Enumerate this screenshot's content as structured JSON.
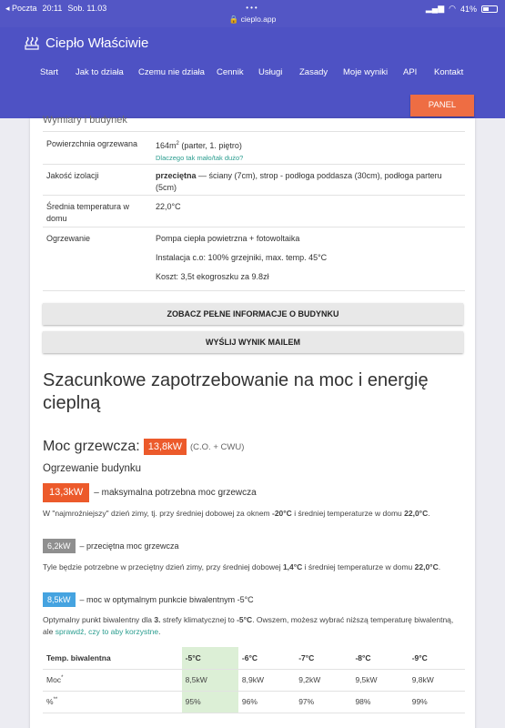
{
  "status": {
    "carrier": "◂ Poczta",
    "time": "20:11",
    "date": "Sob. 11.03",
    "dots": "•••",
    "url": "🔒 cieplo.app",
    "battery": "41%"
  },
  "header": {
    "brand": "Ciepło Właściwie",
    "nav": [
      "Start",
      "Jak to działa",
      "Czemu nie działa",
      "Cennik",
      "Usługi",
      "Zasady",
      "Moje wyniki",
      "API",
      "Kontakt"
    ],
    "panel": "PANEL"
  },
  "building": {
    "cut_title": "Wymiary i budynek",
    "area_label": "Powierzchnia ogrzewana",
    "area_value": "164m",
    "area_sup": "2",
    "area_suffix": " (parter, 1. piętro)",
    "area_hint": "Dlaczego tak mało/tak dużo?",
    "insulation_label": "Jakość izolacji",
    "insulation_strong": "przeciętna",
    "insulation_rest": " — ściany (7cm), strop - podłoga poddasza (30cm), podłoga parteru (5cm)",
    "temp_label": "Średnia temperatura w domu",
    "temp_value": "22,0°C",
    "heating_label": "Ogrzewanie",
    "heating_1": "Pompa ciepła powietrzna + fotowoltaika",
    "heating_2": "Instalacja c.o: 100% grzejniki, max. temp. 45°C",
    "heating_3": "Koszt: 3,5t ekogroszku za 9.8zł"
  },
  "buttons": {
    "full_info": "ZOBACZ PEŁNE INFORMACJE O BUDYNKU",
    "send_mail": "WYŚLIJ WYNIK MAILEM"
  },
  "demand": {
    "heading": "Szacunkowe zapotrzebowanie na moc i energię cieplną",
    "moc_label": "Moc grzewcza:",
    "moc_value": "13,8kW",
    "moc_note": "(C.O. + CWU)",
    "subheading": "Ogrzewanie budynku",
    "max_value": "13,3kW",
    "max_label": "– maksymalna potrzebna moc grzewcza",
    "max_desc_1": "W \"najmroźniejszy\" dzień zimy, tj. przy średniej dobowej za oknem ",
    "max_desc_temp": "-20°C",
    "max_desc_2": " i średniej temperaturze w domu ",
    "max_desc_home": "22,0°C",
    "avg_value": "6,2kW",
    "avg_label": "– przeciętna moc grzewcza",
    "avg_desc_1": "Tyle będzie potrzebne w przeciętny dzień zimy, przy średniej dobowej ",
    "avg_desc_temp": "1,4°C",
    "avg_desc_2": " i średniej temperaturze w domu ",
    "avg_desc_home": "22,0°C",
    "biv_value": "8,5kW",
    "biv_label": "– moc w optymalnym punkcie biwalentnym -5°C",
    "biv_desc_1": "Optymalny punkt biwalentny dla ",
    "biv_desc_zone": "3.",
    "biv_desc_2": " strefy klimatycznej to ",
    "biv_desc_temp": "-5°C",
    "biv_desc_3": ". Owszem, możesz wybrać niższą temperaturę biwalentną, ale ",
    "biv_desc_link": "sprawdź, czy to aby korzystne",
    "biv_desc_4": "."
  },
  "table": {
    "headers": [
      "Temp. biwalentna",
      "-5°C",
      "-6°C",
      "-7°C",
      "-8°C",
      "-9°C"
    ],
    "row1_label": "Moc",
    "row1_sup": "*",
    "row1": [
      "8,5kW",
      "8,9kW",
      "9,2kW",
      "9,5kW",
      "9,8kW"
    ],
    "row2_label": "%",
    "row2_sup": "**",
    "row2": [
      "95%",
      "96%",
      "97%",
      "98%",
      "99%"
    ]
  }
}
